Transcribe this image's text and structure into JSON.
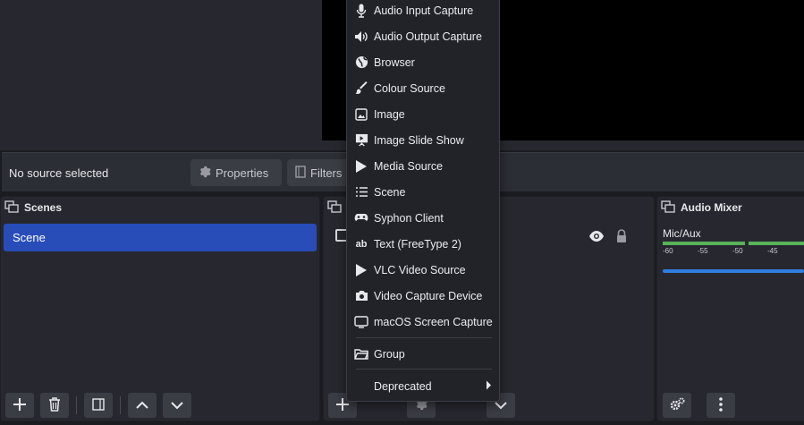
{
  "context_bar": {
    "no_source_text": "No source selected",
    "properties_label": "Properties",
    "filters_label": "Filters"
  },
  "scenes_dock": {
    "title": "Scenes",
    "items": [
      "Scene"
    ]
  },
  "audio_mixer": {
    "title": "Audio Mixer",
    "channel_name": "Mic/Aux",
    "ticks": [
      "-60",
      "-55",
      "-50",
      "-45"
    ]
  },
  "add_source_menu": {
    "items": [
      {
        "label": "Audio Input Capture",
        "icon": "microphone-icon"
      },
      {
        "label": "Audio Output Capture",
        "icon": "speaker-icon"
      },
      {
        "label": "Browser",
        "icon": "globe-icon"
      },
      {
        "label": "Colour Source",
        "icon": "paintbrush-icon"
      },
      {
        "label": "Image",
        "icon": "image-icon"
      },
      {
        "label": "Image Slide Show",
        "icon": "slideshow-icon"
      },
      {
        "label": "Media Source",
        "icon": "play-icon"
      },
      {
        "label": "Scene",
        "icon": "list-icon"
      },
      {
        "label": "Syphon Client",
        "icon": "gamepad-icon"
      },
      {
        "label": "Text (FreeType 2)",
        "icon": "text-icon"
      },
      {
        "label": "VLC Video Source",
        "icon": "play-icon"
      },
      {
        "label": "Video Capture Device",
        "icon": "camera-icon"
      },
      {
        "label": "macOS Screen Capture",
        "icon": "monitor-icon"
      }
    ],
    "group_label": "Group",
    "deprecated_label": "Deprecated"
  },
  "colors": {
    "selected_scene": "#284cb8",
    "meter_green": "#58b35a",
    "volume_blue": "#2f7fe0"
  }
}
